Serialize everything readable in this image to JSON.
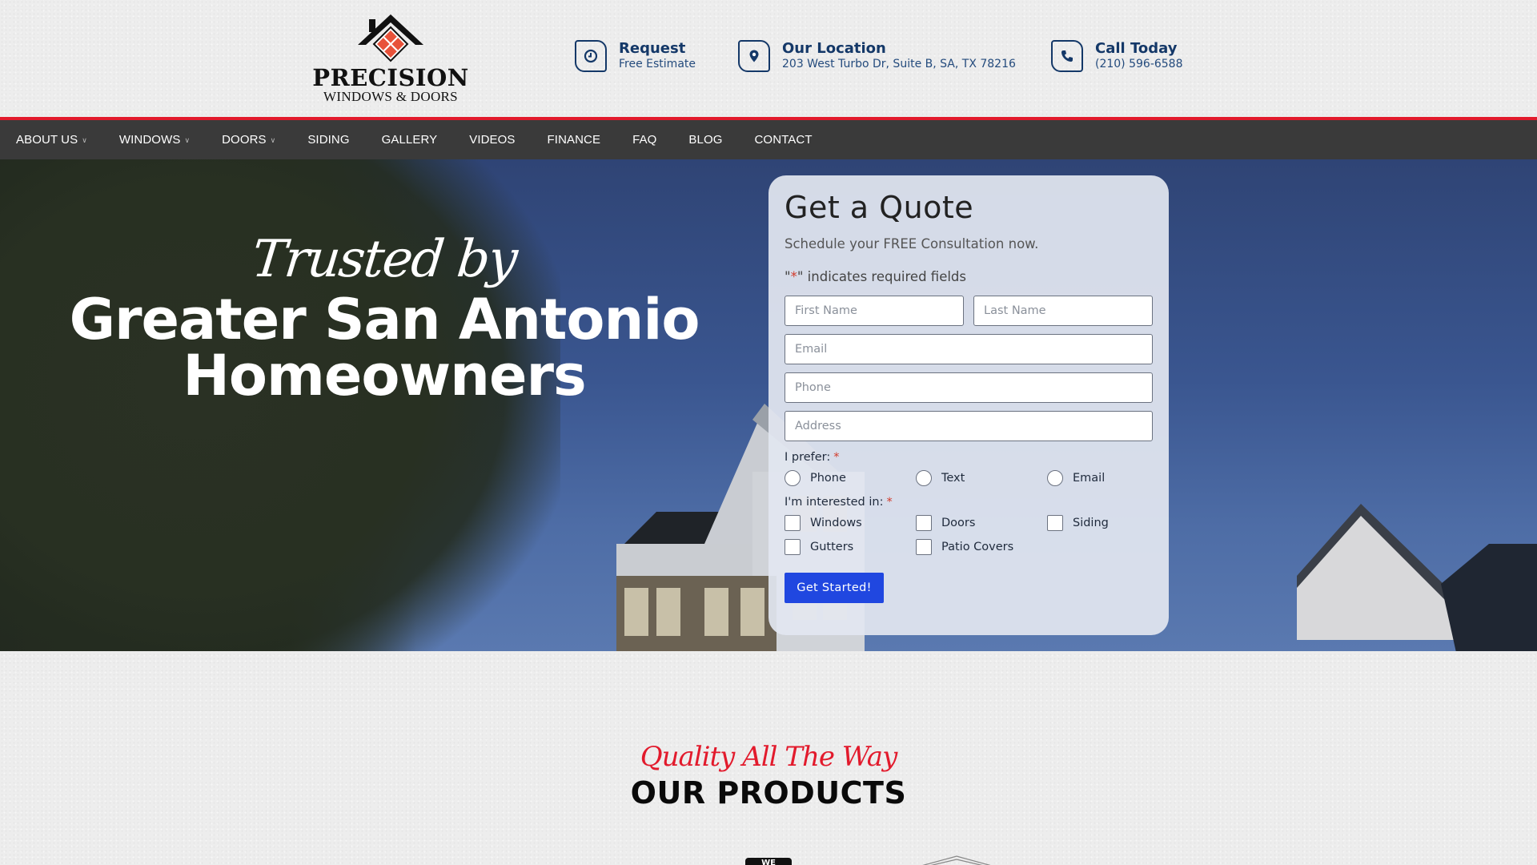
{
  "brand": {
    "name": "PRECISION",
    "tagline": "WINDOWS & DOORS"
  },
  "header_info": [
    {
      "icon": "clock-icon",
      "title": "Request",
      "subtitle": "Free Estimate"
    },
    {
      "icon": "map-pin-icon",
      "title": "Our Location",
      "subtitle": "203 West Turbo Dr, Suite B, SA, TX 78216"
    },
    {
      "icon": "phone-icon",
      "title": "Call Today",
      "subtitle": "(210) 596-6588"
    }
  ],
  "nav": [
    {
      "label": "ABOUT US",
      "dropdown": true
    },
    {
      "label": "WINDOWS",
      "dropdown": true
    },
    {
      "label": "DOORS",
      "dropdown": true
    },
    {
      "label": "SIDING",
      "dropdown": false
    },
    {
      "label": "GALLERY",
      "dropdown": false
    },
    {
      "label": "VIDEOS",
      "dropdown": false
    },
    {
      "label": "FINANCE",
      "dropdown": false
    },
    {
      "label": "FAQ",
      "dropdown": false
    },
    {
      "label": "BLOG",
      "dropdown": false
    },
    {
      "label": "CONTACT",
      "dropdown": false
    }
  ],
  "hero": {
    "script": "Trusted by",
    "headline_line1": "Greater San Antonio",
    "headline_line2": "Homeowners"
  },
  "form": {
    "title": "Get a Quote",
    "subtitle": "Schedule your FREE Consultation now.",
    "required_note_prefix": "\"",
    "required_star": "*",
    "required_note_suffix": "\" indicates required fields",
    "fields": {
      "first_name": {
        "placeholder": "First Name",
        "value": ""
      },
      "last_name": {
        "placeholder": "Last Name",
        "value": ""
      },
      "email": {
        "placeholder": "Email",
        "value": ""
      },
      "phone": {
        "placeholder": "Phone",
        "value": ""
      },
      "address": {
        "placeholder": "Address",
        "value": ""
      }
    },
    "prefer_label": "I prefer:",
    "prefer_options": [
      "Phone",
      "Text",
      "Email"
    ],
    "interest_label": "I'm interested in:",
    "interest_options": [
      "Windows",
      "Doors",
      "Siding",
      "Gutters",
      "Patio Covers"
    ],
    "required_marker": "*",
    "submit_label": "Get Started!"
  },
  "products": {
    "script": "Quality All The Way",
    "title": "OUR PRODUCTS",
    "badge": "WE OFFER"
  },
  "colors": {
    "navy": "#143868",
    "red": "#e21a2c",
    "nav_bg": "#3a3a3a",
    "button_blue": "#2047e0"
  }
}
